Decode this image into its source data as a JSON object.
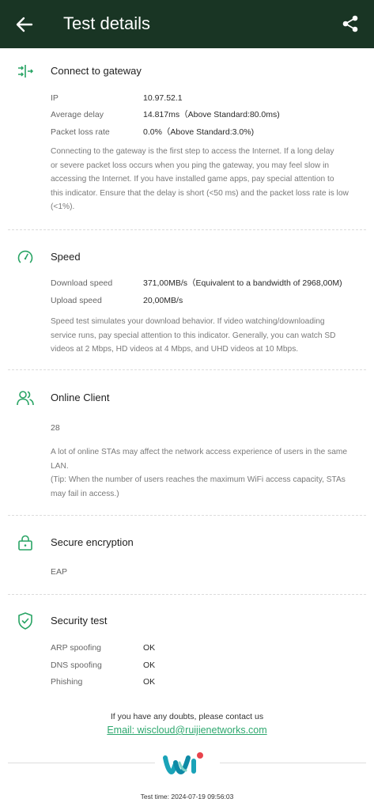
{
  "header": {
    "title": "Test details",
    "back_icon": "arrow-left-icon",
    "share_icon": "share-icon",
    "bg_color": "#193524"
  },
  "gateway": {
    "title": "Connect to gateway",
    "icon": "gateway-connect-icon",
    "rows": [
      {
        "label": "IP",
        "value": "10.97.52.1"
      },
      {
        "label": "Average delay",
        "value": "14.817ms（Above Standard:80.0ms)"
      },
      {
        "label": "Packet loss rate",
        "value": "0.0%（Above Standard:3.0%)"
      }
    ],
    "desc_lines": [
      "Connecting to the gateway is the first step to access the Internet. If a long delay",
      "or severe packet loss occurs when you ping the gateway, you may feel slow in",
      "accessing the Internet. If you have installed game apps, pay special attention to",
      "this indicator. Ensure that the delay is short (<50 ms) and the packet loss rate is low",
      "(<1%)."
    ]
  },
  "speed": {
    "title": "Speed",
    "icon": "speedometer-icon",
    "rows": [
      {
        "label": "Download speed",
        "value": "371,00MB/s（Equivalent to a bandwidth of 2968,00M)"
      },
      {
        "label": "Upload speed",
        "value": "20,00MB/s"
      }
    ],
    "desc_lines": [
      "Speed test simulates your download behavior. If video watching/downloading",
      "service runs, pay special attention to this indicator. Generally, you can watch SD",
      "videos at 2 Mbps, HD videos at 4 Mbps, and UHD videos at 10 Mbps."
    ]
  },
  "clients": {
    "title": "Online Client",
    "icon": "users-icon",
    "count": "28",
    "desc_lines": [
      "A lot of online STAs may affect the network access experience of users in the same",
      "LAN.",
      "(Tip: When the number of users reaches the maximum WiFi access capacity, STAs",
      "may fail in access.)"
    ]
  },
  "encryption": {
    "title": "Secure encryption",
    "icon": "lock-icon",
    "value": "EAP"
  },
  "security": {
    "title": "Security test",
    "icon": "shield-check-icon",
    "rows": [
      {
        "label": "ARP spoofing",
        "value": "OK"
      },
      {
        "label": "DNS spoofing",
        "value": "OK"
      },
      {
        "label": "Phishing",
        "value": "OK"
      }
    ]
  },
  "footer": {
    "contact_text": "If you have any doubts, please contact us",
    "email": "Email: wiscloud@ruijienetworks.com",
    "logo": "wi-logo-icon",
    "test_time": "Test time: 2024-07-19 09:56:03"
  },
  "colors": {
    "accent": "#2ea86f",
    "icon_green": "#28a464",
    "logo_teal": "#1aa3b8",
    "logo_red": "#e8434c"
  }
}
